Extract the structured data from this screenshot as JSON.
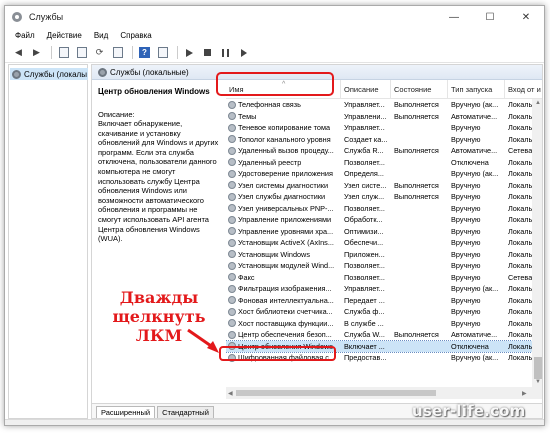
{
  "window": {
    "title": "Службы"
  },
  "window_controls": {
    "minimize": "—",
    "maximize": "☐",
    "close": "✕"
  },
  "menu": [
    "Файл",
    "Действие",
    "Вид",
    "Справка"
  ],
  "tree": {
    "root": "Службы (локалы"
  },
  "pane": {
    "header": "Службы (локальные)"
  },
  "description": {
    "title": "Центр обновления Windows",
    "label": "Описание:",
    "text": "Включает обнаружение, скачивание и установку обновлений для Windows и других программ. Если эта служба отключена, пользователи данного компьютера не смогут использовать службу Центра обновления Windows или возможности автоматического обновления и программы не смогут использовать API агента Центра обновления Windows (WUA)."
  },
  "columns": [
    "Имя",
    "Описание",
    "Состояние",
    "Тип запуска",
    "Вход от и"
  ],
  "rows": [
    [
      "Телефонная связь",
      "Управляет...",
      "Выполняется",
      "Вручную (ак...",
      "Локальн"
    ],
    [
      "Темы",
      "Управлени...",
      "Выполняется",
      "Автоматиче...",
      "Локальн"
    ],
    [
      "Теневое копирование тома",
      "Управляет...",
      "",
      "Вручную",
      "Локальн"
    ],
    [
      "Тополог канального уровня",
      "Создает ка...",
      "",
      "Вручную",
      "Локальн"
    ],
    [
      "Удаленный вызов процеду...",
      "Служба R...",
      "Выполняется",
      "Автоматиче...",
      "Сетевая с"
    ],
    [
      "Удаленный реестр",
      "Позволяет...",
      "",
      "Отключена",
      "Локальн"
    ],
    [
      "Удостоверение приложения",
      "Определя...",
      "",
      "Вручную (ак...",
      "Локальн"
    ],
    [
      "Узел системы диагностики",
      "Узел систе...",
      "Выполняется",
      "Вручную",
      "Локальн"
    ],
    [
      "Узел службы диагностики",
      "Узел служ...",
      "Выполняется",
      "Вручную",
      "Локальн"
    ],
    [
      "Узел универсальных PNP-...",
      "Позволяет...",
      "",
      "Вручную",
      "Локальн"
    ],
    [
      "Управление приложениями",
      "Обработк...",
      "",
      "Вручную",
      "Локальн"
    ],
    [
      "Управление уровнями хра...",
      "Оптимизи...",
      "",
      "Вручную",
      "Локальн"
    ],
    [
      "Установщик ActiveX (AxIns...",
      "Обеспечи...",
      "",
      "Вручную",
      "Локальн"
    ],
    [
      "Установщик Windows",
      "Приложен...",
      "",
      "Вручную",
      "Локальн"
    ],
    [
      "Установщик модулей Wind...",
      "Позволяет...",
      "",
      "Вручную",
      "Локальн"
    ],
    [
      "Факс",
      "Позволяет...",
      "",
      "Вручную",
      "Сетевая с"
    ],
    [
      "Фильтрация изображения...",
      "Управляет...",
      "",
      "Вручную (ак...",
      "Локальн"
    ],
    [
      "Фоновая интеллектуальна...",
      "Передает ...",
      "",
      "Вручную",
      "Локальн"
    ],
    [
      "Хост библиотеки счетчика...",
      "Служба ф...",
      "",
      "Вручную",
      "Локальн"
    ],
    [
      "Хост поставщика функции...",
      "В службе ...",
      "",
      "Вручную",
      "Локальн"
    ],
    [
      "Центр обеспечения безоп...",
      "Служба W...",
      "Выполняется",
      "Автоматиче...",
      "Локальн"
    ],
    [
      "Центр обновления Windows",
      "Включает ...",
      "",
      "Отключена",
      "Локальн"
    ],
    [
      "Шифрованная файловая с...",
      "Предостав...",
      "",
      "Вручную (ак...",
      "Локальн"
    ]
  ],
  "selected_row": 21,
  "tabs": [
    "Расширенный",
    "Стандартный"
  ],
  "annotation": {
    "line1": "Дважды",
    "line2": "щелкнуть ЛКМ",
    "color": "#e3191b"
  },
  "watermark": "user-life.com"
}
